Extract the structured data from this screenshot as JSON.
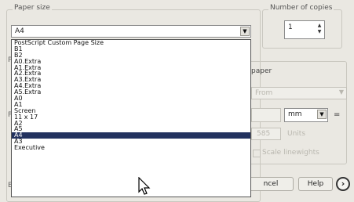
{
  "paper_size": {
    "title": "Paper size",
    "value": "A4",
    "options": [
      "PostScript Custom Page Size",
      "B1",
      "B2",
      "A0.Extra",
      "A1.Extra",
      "A2.Extra",
      "A3.Extra",
      "A4.Extra",
      "A5.Extra",
      "A0",
      "A1",
      "Screen",
      "11 x 17",
      "A2",
      "A5",
      "A4",
      "A3",
      "Executive"
    ],
    "selected_index": 15
  },
  "number_of_copies": {
    "title": "Number of copies",
    "value": "1"
  },
  "paper_panel": {
    "label": "paper",
    "source_value": "From",
    "unit_value": "mm",
    "units_label": "Units",
    "units_number": "585",
    "scale_label": "Scale linewights"
  },
  "buttons": {
    "cancel": "ncel",
    "help": "Help"
  },
  "left_letters": [
    "P",
    "P",
    "E"
  ]
}
